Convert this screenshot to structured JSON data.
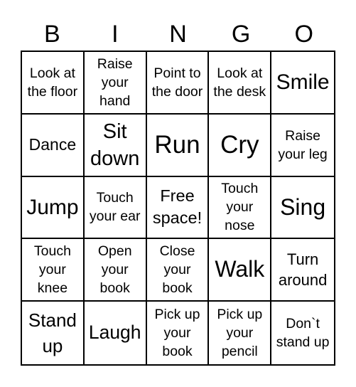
{
  "header": {
    "letters": [
      "B",
      "I",
      "N",
      "G",
      "O"
    ]
  },
  "grid": {
    "rows": [
      [
        "Look at the floor",
        "Raise your hand",
        "Point to the door",
        "Look at the desk",
        "Smile"
      ],
      [
        "Dance",
        "Sit down",
        "Run",
        "Cry",
        "Raise your leg"
      ],
      [
        "Jump",
        "Touch your ear",
        "Free space!",
        "Touch your nose",
        "Sing"
      ],
      [
        "Touch your knee",
        "Open your book",
        "Close your book",
        "Walk",
        "Turn around"
      ],
      [
        "Stand up",
        "Laugh",
        "Pick up your book",
        "Pick up your pencil",
        "Don`t stand up"
      ]
    ]
  },
  "colors": {
    "line": "#000000",
    "background": "#ffffff",
    "text": "#000000"
  }
}
